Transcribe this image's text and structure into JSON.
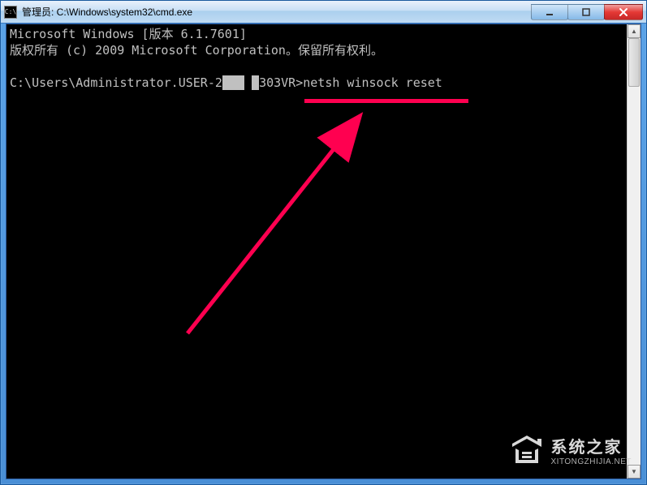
{
  "window": {
    "title": "管理员: C:\\Windows\\system32\\cmd.exe",
    "icon_label": "C:\\"
  },
  "terminal": {
    "line1": "Microsoft Windows [版本 6.1.7601]",
    "line2": "版权所有 (c) 2009 Microsoft Corporation。保留所有权利。",
    "line3": "",
    "prompt_part1": "C:\\Users\\Administrator.USER-2",
    "prompt_redacted1": "   ",
    "prompt_redacted2": " ",
    "prompt_part2": "303VR>",
    "command": "netsh winsock reset"
  },
  "controls": {
    "minimize_label": "minimize",
    "maximize_label": "maximize",
    "close_label": "close"
  },
  "watermark": {
    "title": "系统之家",
    "url": "XITONGZHIJIA.NET"
  },
  "annotation": {
    "underline_color": "#ff0050",
    "arrow_color": "#ff0050"
  }
}
